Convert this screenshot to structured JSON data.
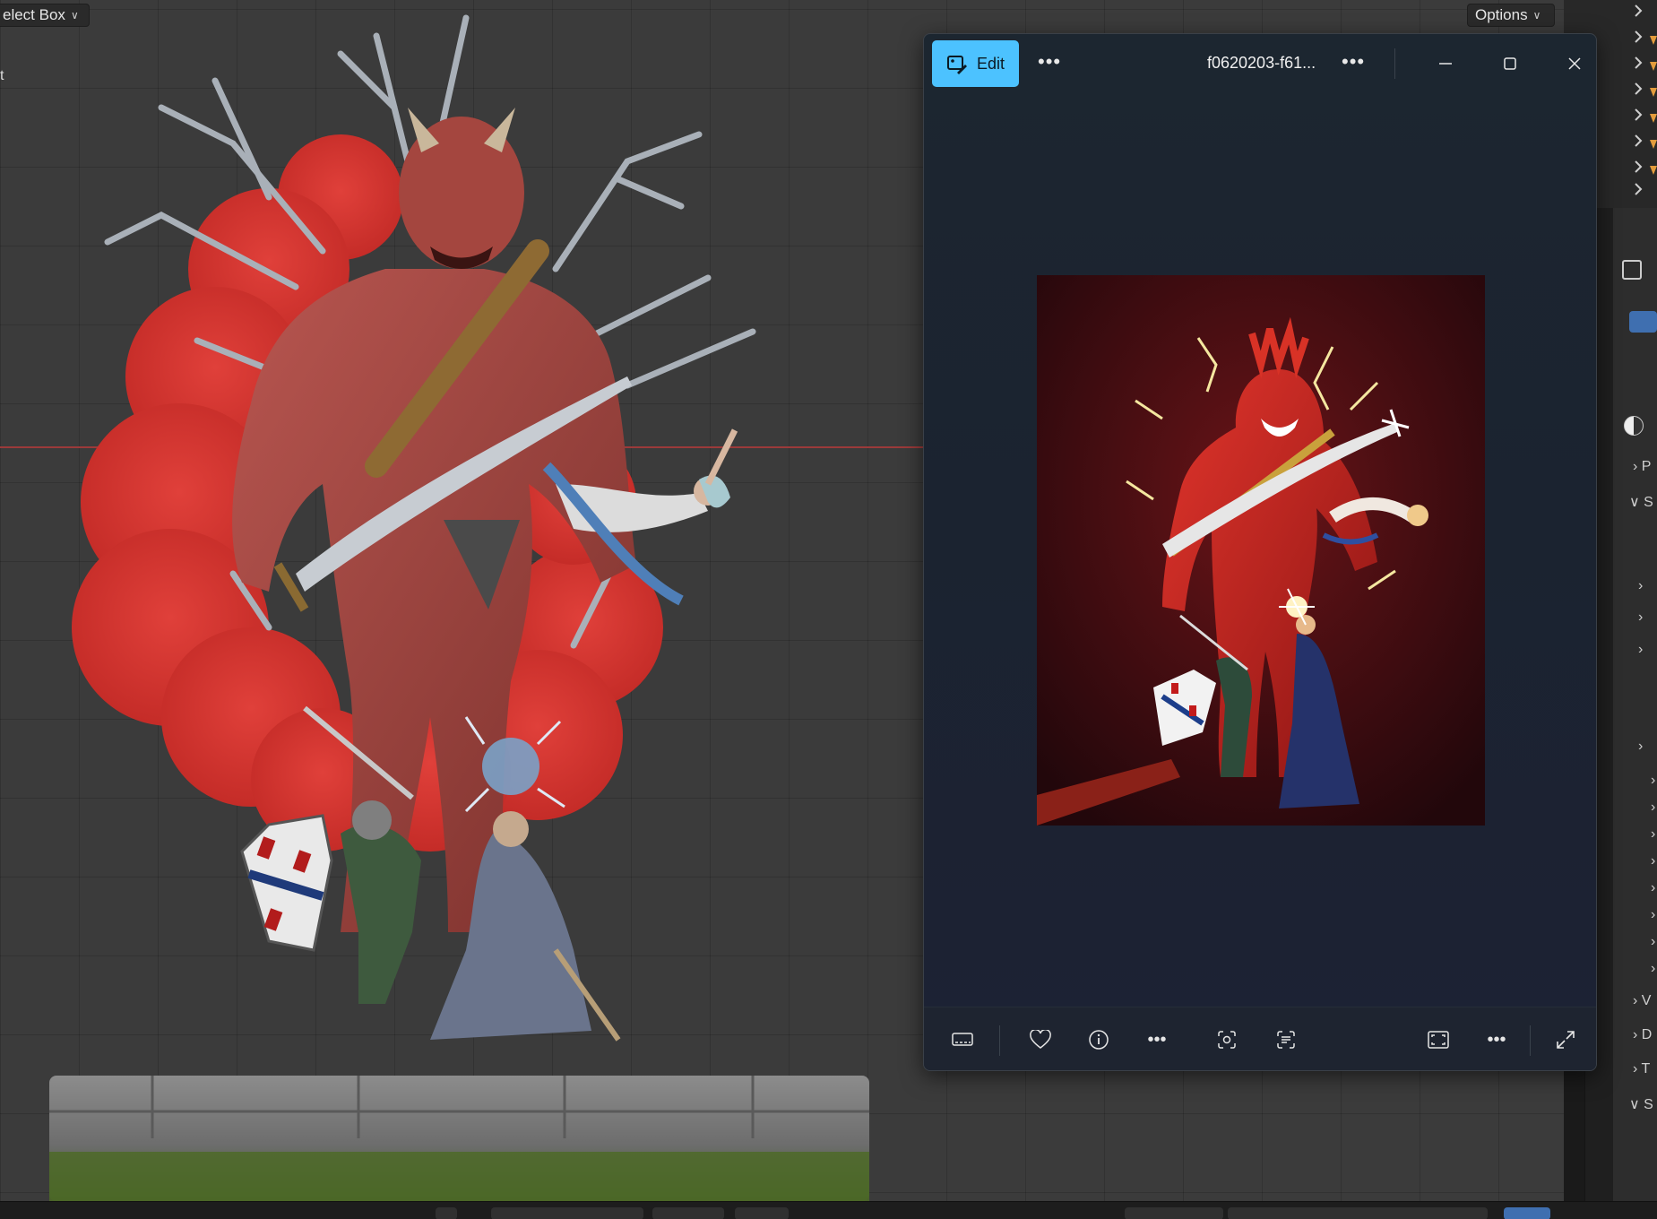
{
  "viewport": {
    "select_box_label": "elect Box",
    "options_label": "Options",
    "edge_text": "t"
  },
  "photos": {
    "edit_label": "Edit",
    "file_title": "f0620203-f61...",
    "accent_color": "#4cc2ff"
  },
  "properties": {
    "panel_letters": [
      "P",
      "S",
      "V",
      "D",
      "T",
      "S"
    ]
  }
}
